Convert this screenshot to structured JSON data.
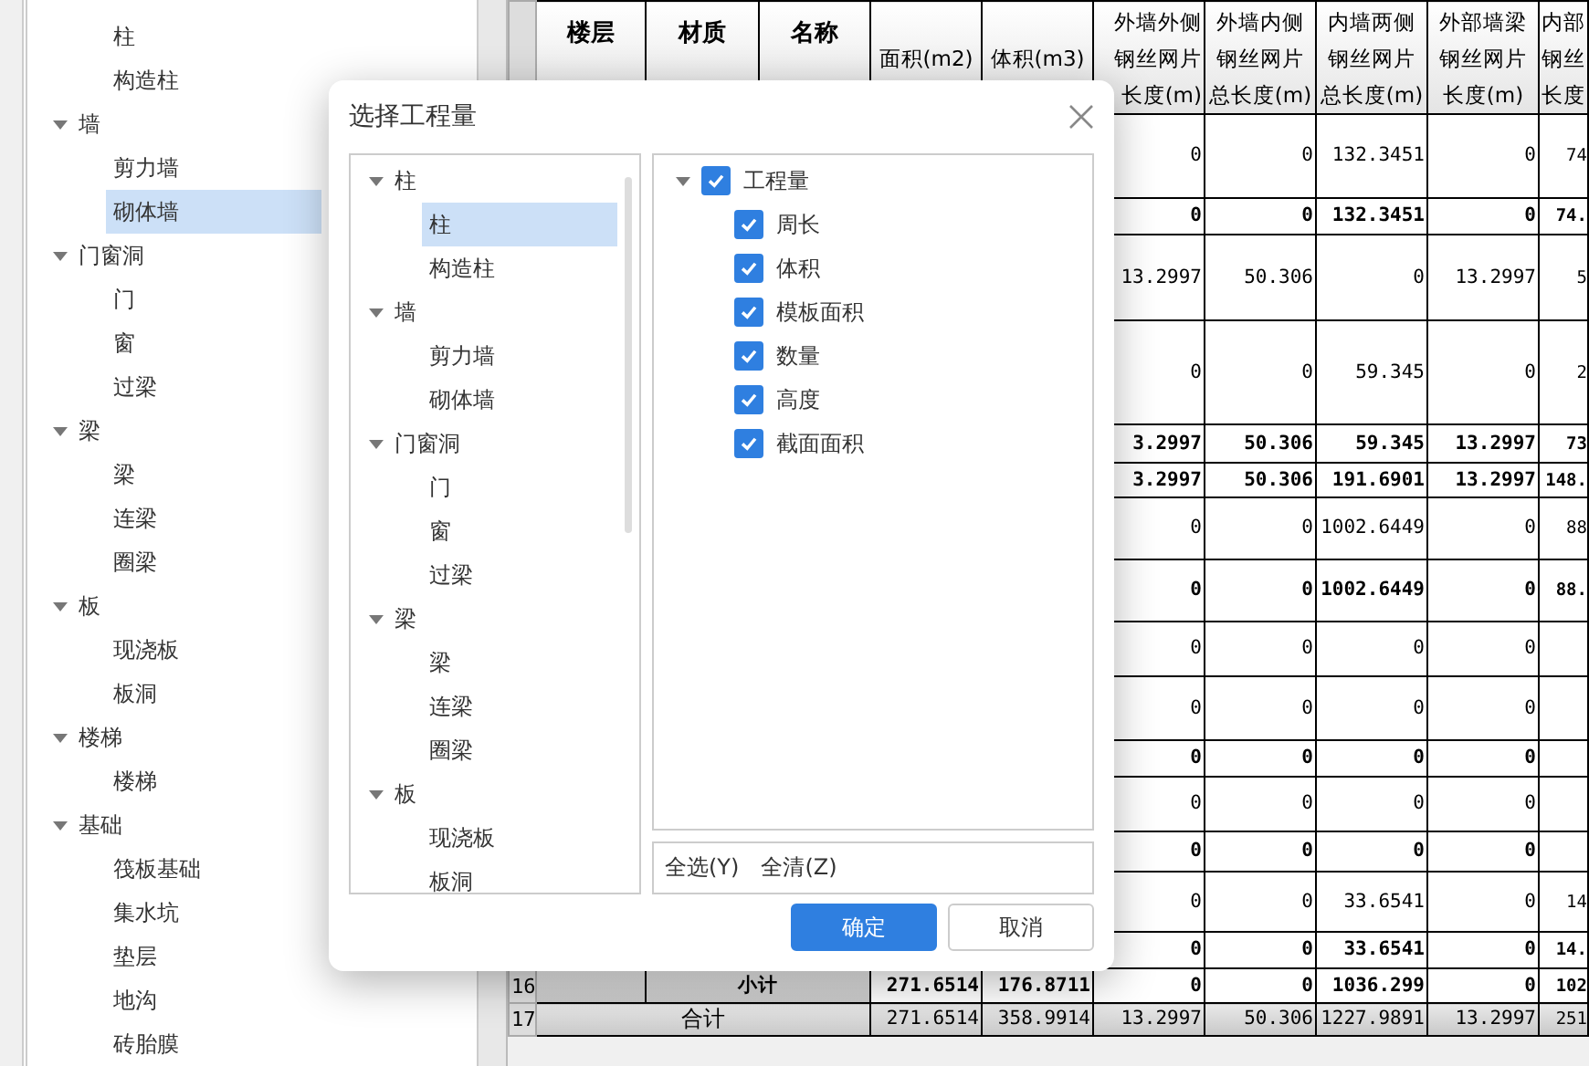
{
  "side_tree": [
    {
      "children": [
        {
          "label": "柱",
          "selected": false
        },
        {
          "label": "构造柱",
          "selected": false
        }
      ]
    },
    {
      "label": "墙",
      "expanded": true,
      "children": [
        {
          "label": "剪力墙",
          "selected": false
        },
        {
          "label": "砌体墙",
          "selected": true
        }
      ]
    },
    {
      "label": "门窗洞",
      "expanded": true,
      "children": [
        {
          "label": "门",
          "selected": false
        },
        {
          "label": "窗",
          "selected": false
        },
        {
          "label": "过梁",
          "selected": false
        }
      ]
    },
    {
      "label": "梁",
      "expanded": true,
      "children": [
        {
          "label": "梁",
          "selected": false
        },
        {
          "label": "连梁",
          "selected": false
        },
        {
          "label": "圈梁",
          "selected": false
        }
      ]
    },
    {
      "label": "板",
      "expanded": true,
      "children": [
        {
          "label": "现浇板",
          "selected": false
        },
        {
          "label": "板洞",
          "selected": false
        }
      ]
    },
    {
      "label": "楼梯",
      "expanded": true,
      "children": [
        {
          "label": "楼梯",
          "selected": false
        }
      ]
    },
    {
      "label": "基础",
      "expanded": true,
      "children": [
        {
          "label": "筏板基础",
          "selected": false
        },
        {
          "label": "集水坑",
          "selected": false
        },
        {
          "label": "垫层",
          "selected": false
        },
        {
          "label": "地沟",
          "selected": false
        },
        {
          "label": "砖胎膜",
          "selected": false
        }
      ]
    }
  ],
  "table": {
    "columns": [
      {
        "lines": [
          "楼层"
        ],
        "bold": true
      },
      {
        "lines": [
          "材质"
        ],
        "bold": true
      },
      {
        "lines": [
          "名称"
        ],
        "bold": true
      },
      {
        "lines": [
          "面积(m2)"
        ],
        "bold": false
      },
      {
        "lines": [
          "体积(m3)"
        ],
        "bold": false
      },
      {
        "lines": [
          "外墙外侧",
          "钢丝网片",
          "长度(m)"
        ],
        "bold": false
      },
      {
        "lines": [
          "外墙内侧",
          "钢丝网片",
          "总长度(m)"
        ],
        "bold": false
      },
      {
        "lines": [
          "内墙两侧",
          "钢丝网片",
          "总长度(m)"
        ],
        "bold": false
      },
      {
        "lines": [
          "外部墙梁",
          "钢丝网片",
          "长度(m)"
        ],
        "bold": false
      },
      {
        "lines": [
          "内部",
          "钢丝",
          "长度"
        ],
        "bold": false
      }
    ],
    "rows": [
      {
        "bold": false,
        "cells": [
          "0",
          "0",
          "132.3451",
          "0",
          "74"
        ]
      },
      {
        "bold": true,
        "cells": [
          "0",
          "0",
          "132.3451",
          "0",
          "74."
        ]
      },
      {
        "bold": false,
        "cells": [
          "13.2997",
          "50.306",
          "0",
          "13.2997",
          "5"
        ]
      },
      {
        "bold": false,
        "cells": [
          "0",
          "0",
          "59.345",
          "0",
          "2"
        ]
      },
      {
        "bold": true,
        "cells": [
          "3.2997",
          "50.306",
          "59.345",
          "13.2997",
          "73"
        ]
      },
      {
        "bold": true,
        "cells": [
          "3.2997",
          "50.306",
          "191.6901",
          "13.2997",
          "148."
        ]
      },
      {
        "bold": false,
        "cells": [
          "0",
          "0",
          "1002.6449",
          "0",
          "88"
        ]
      },
      {
        "bold": true,
        "cells": [
          "0",
          "0",
          "1002.6449",
          "0",
          "88."
        ]
      },
      {
        "bold": false,
        "cells": [
          "0",
          "0",
          "0",
          "0"
        ]
      },
      {
        "bold": false,
        "cells": [
          "0",
          "0",
          "0",
          "0"
        ]
      },
      {
        "bold": true,
        "cells": [
          "0",
          "0",
          "0",
          "0"
        ]
      },
      {
        "bold": false,
        "cells": [
          "0",
          "0",
          "0",
          "0"
        ]
      },
      {
        "bold": true,
        "cells": [
          "0",
          "0",
          "0",
          "0"
        ]
      },
      {
        "bold": false,
        "cells": [
          "0",
          "0",
          "33.6541",
          "0",
          "14"
        ]
      },
      {
        "bold": true,
        "cells": [
          "0",
          "0",
          "33.6541",
          "0",
          "14."
        ]
      }
    ],
    "totals": [
      {
        "kind": "subtotal",
        "number": "16",
        "label": "小计",
        "cells": [
          "271.6514",
          "176.8711",
          "0",
          "0",
          "1036.299",
          "0",
          "102"
        ]
      },
      {
        "kind": "total",
        "number": "17",
        "label": "合计",
        "cells": [
          "271.6514",
          "358.9914",
          "13.2997",
          "50.306",
          "1227.9891",
          "13.2997",
          "251"
        ]
      }
    ]
  },
  "dialog": {
    "title": "选择工程量",
    "tree": [
      {
        "label": "柱",
        "expanded": true,
        "children": [
          {
            "label": "柱",
            "selected": true
          },
          {
            "label": "构造柱",
            "selected": false
          }
        ]
      },
      {
        "label": "墙",
        "expanded": true,
        "children": [
          {
            "label": "剪力墙",
            "selected": false
          },
          {
            "label": "砌体墙",
            "selected": false
          }
        ]
      },
      {
        "label": "门窗洞",
        "expanded": true,
        "children": [
          {
            "label": "门",
            "selected": false
          },
          {
            "label": "窗",
            "selected": false
          },
          {
            "label": "过梁",
            "selected": false
          }
        ]
      },
      {
        "label": "梁",
        "expanded": true,
        "children": [
          {
            "label": "梁",
            "selected": false
          },
          {
            "label": "连梁",
            "selected": false
          },
          {
            "label": "圈梁",
            "selected": false
          }
        ]
      },
      {
        "label": "板",
        "expanded": true,
        "children": [
          {
            "label": "现浇板",
            "selected": false
          },
          {
            "label": "板洞",
            "selected": false
          }
        ]
      }
    ],
    "quantities": {
      "label": "工程量",
      "checked": true,
      "expanded": true,
      "children": [
        {
          "label": "周长",
          "checked": true
        },
        {
          "label": "体积",
          "checked": true
        },
        {
          "label": "模板面积",
          "checked": true
        },
        {
          "label": "数量",
          "checked": true
        },
        {
          "label": "高度",
          "checked": true
        },
        {
          "label": "截面面积",
          "checked": true
        }
      ]
    },
    "links": [
      "全选(Y)",
      "全清(Z)"
    ],
    "buttons": [
      {
        "label": "确定",
        "kind": "primary"
      },
      {
        "label": "取消",
        "kind": "default"
      }
    ]
  }
}
